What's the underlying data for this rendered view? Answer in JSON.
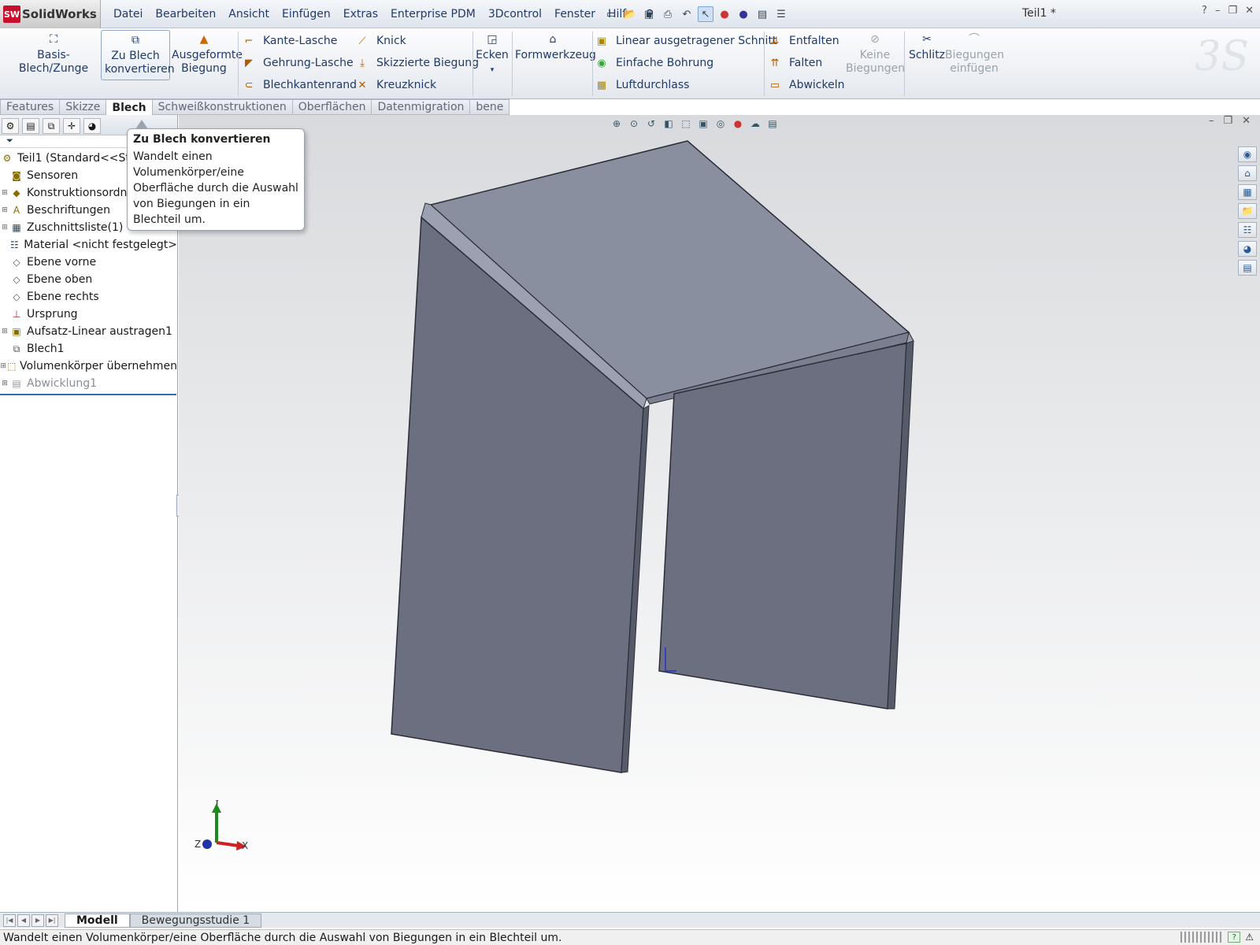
{
  "app": {
    "name": "SolidWorks",
    "logo_badge": "SW",
    "document_title": "Teil1 *"
  },
  "menu": [
    "Datei",
    "Bearbeiten",
    "Ansicht",
    "Einfügen",
    "Extras",
    "Enterprise PDM",
    "3Dcontrol",
    "Fenster",
    "Hilfe"
  ],
  "toolbar_icons": [
    "pin-icon",
    "new-document-icon",
    "open-icon",
    "save-icon",
    "print-icon",
    "undo-icon",
    "select-pointer-icon",
    "traffic-light-icon",
    "rebuild-icon",
    "file-properties-icon",
    "options-icon"
  ],
  "ribbon": {
    "big_buttons": {
      "base_flange": "Basis-Blech/Zunge",
      "convert_sheet": [
        "Zu Blech",
        "konvertieren"
      ],
      "lofted_bend": [
        "Ausgeformte",
        "Biegung"
      ],
      "corners": "Ecken",
      "forming_tool": "Formwerkzeug",
      "no_bends": [
        "Keine",
        "Biegungen"
      ],
      "rip": "Schlitz",
      "insert_bends": [
        "Biegungen",
        "einfügen"
      ]
    },
    "small_buttons": {
      "edge_flange": "Kante-Lasche",
      "miter_flange": "Gehrung-Lasche",
      "hem": "Blechkantenrand",
      "jog": "Knick",
      "sketched_bend": "Skizzierte Biegung",
      "cross_break": "Kreuzknick",
      "extruded_cut": "Linear ausgetragener Schnitt",
      "simple_hole": "Einfache Bohrung",
      "vent": "Luftdurchlass",
      "unfold": "Entfalten",
      "fold": "Falten",
      "flatten": "Abwickeln"
    },
    "brand_watermark": "3S"
  },
  "tabs": [
    {
      "label": "Features",
      "active": false
    },
    {
      "label": "Skizze",
      "active": false
    },
    {
      "label": "Blech",
      "active": true
    },
    {
      "label": "Schweißkonstruktionen",
      "active": false
    },
    {
      "label": "Oberflächen",
      "active": false
    },
    {
      "label": "Datenmigration",
      "active": false
    },
    {
      "label": "bene",
      "active": false
    }
  ],
  "tooltip": {
    "title": "Zu Blech konvertieren",
    "body": "Wandelt einen Volumenkörper/eine Oberfläche durch die Auswahl von Biegungen in ein Blechteil um."
  },
  "feature_tree": [
    {
      "label": "Teil1  (Standard<<St",
      "expand": false,
      "icon": "part-icon",
      "root": true
    },
    {
      "label": "Sensoren",
      "expand": false,
      "icon": "sensor-icon"
    },
    {
      "label": "Konstruktionsordn",
      "expand": true,
      "icon": "design-binder-icon"
    },
    {
      "label": "Beschriftungen",
      "expand": true,
      "icon": "annotations-icon"
    },
    {
      "label": "Zuschnittsliste(1)",
      "expand": true,
      "icon": "cut-list-icon"
    },
    {
      "label": "Material <nicht festgelegt>",
      "expand": false,
      "icon": "material-icon"
    },
    {
      "label": "Ebene vorne",
      "expand": false,
      "icon": "plane-icon"
    },
    {
      "label": "Ebene oben",
      "expand": false,
      "icon": "plane-icon"
    },
    {
      "label": "Ebene rechts",
      "expand": false,
      "icon": "plane-icon"
    },
    {
      "label": "Ursprung",
      "expand": false,
      "icon": "origin-icon"
    },
    {
      "label": "Aufsatz-Linear austragen1",
      "expand": true,
      "icon": "extrude-icon"
    },
    {
      "label": "Blech1",
      "expand": false,
      "icon": "sheet-metal-icon"
    },
    {
      "label": "Volumenkörper übernehmen",
      "expand": true,
      "icon": "body-icon"
    },
    {
      "label": "Abwicklung1",
      "expand": true,
      "icon": "flat-pattern-icon",
      "dim": true
    }
  ],
  "triad": {
    "x": "X",
    "y": "Y",
    "z": "Z"
  },
  "bottom_tabs": [
    {
      "label": "Modell",
      "active": true
    },
    {
      "label": "Bewegungsstudie 1",
      "active": false
    }
  ],
  "status_text": "Wandelt einen Volumenkörper/eine Oberfläche durch die Auswahl von Biegungen in ein Blechteil um.",
  "colors": {
    "menu_text": "#1f3a6b",
    "model_top": "#8a8fa0",
    "model_side": "#6b6f80",
    "accent_blue": "#2c6db3"
  }
}
